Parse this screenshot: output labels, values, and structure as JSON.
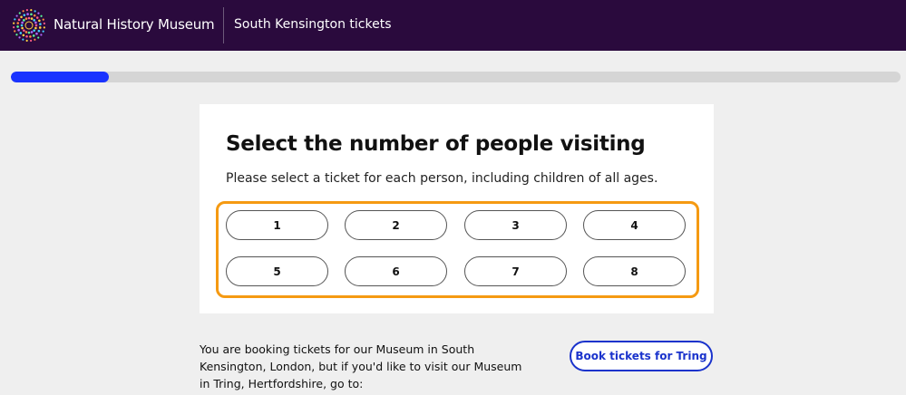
{
  "header": {
    "brand": "Natural History Museum",
    "subtitle": "South Kensington tickets",
    "logo_icon": "nhm-starburst-logo-icon",
    "background_color": "#2a0a3d"
  },
  "progress": {
    "fraction": 0.11,
    "fill_color": "#1a33ff",
    "track_color": "#d5d5d5"
  },
  "card": {
    "title": "Select the number of people visiting",
    "description": "Please select a ticket for each person, including children of all ages.",
    "options": [
      "1",
      "2",
      "3",
      "4",
      "5",
      "6",
      "7",
      "8"
    ],
    "highlight_color": "#f59a12"
  },
  "footer": {
    "info_text": "You are booking tickets for our Museum in South Kensington, London, but if you'd like to visit our Museum in Tring, Hertfordshire, go to:",
    "tring_button": "Book tickets for Tring",
    "accent_color": "#1a33cc"
  }
}
